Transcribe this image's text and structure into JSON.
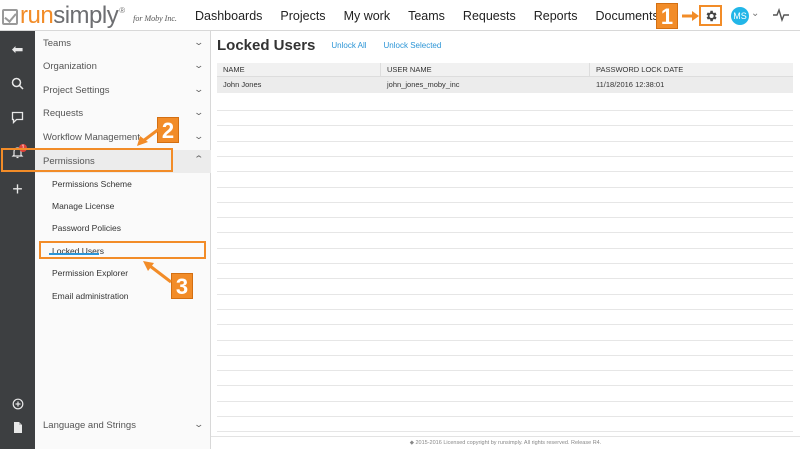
{
  "logo": {
    "run": "run",
    "simply": "simply",
    "reg": "®",
    "for_text": "for Moby Inc."
  },
  "nav": [
    "Dashboards",
    "Projects",
    "My work",
    "Teams",
    "Requests",
    "Reports",
    "Documents"
  ],
  "user": {
    "initials": "MS"
  },
  "rail_icons": [
    "back-arrow-icon",
    "search-icon",
    "chat-icon",
    "bell-icon",
    "plus-icon",
    "add-circle-icon",
    "document-icon"
  ],
  "notifications_badge": "1",
  "sidebar": {
    "items": [
      {
        "label": "Teams"
      },
      {
        "label": "Organization"
      },
      {
        "label": "Project Settings"
      },
      {
        "label": "Requests"
      },
      {
        "label": "Workflow Management"
      },
      {
        "label": "Permissions"
      }
    ],
    "sub_items": [
      {
        "label": "Permissions Scheme"
      },
      {
        "label": "Manage License"
      },
      {
        "label": "Password Policies"
      },
      {
        "label": "Locked Users"
      },
      {
        "label": "Permission Explorer"
      },
      {
        "label": "Email administration"
      }
    ],
    "bottom_item": {
      "label": "Language and Strings"
    }
  },
  "main": {
    "title": "Locked Users",
    "unlock_all": "Unlock All",
    "unlock_selected": "Unlock Selected",
    "columns": [
      "NAME",
      "USER NAME",
      "PASSWORD LOCK DATE"
    ],
    "rows": [
      {
        "name": "John Jones",
        "username": "john_jones_moby_inc",
        "lock_date": "11/18/2016 12:38:01"
      }
    ]
  },
  "footer": "◆ 2015-2016 Licensed copyright by runsimply. All rights reserved. Release R4.",
  "callouts": [
    "1",
    "2",
    "3"
  ],
  "colors": {
    "accent": "#f28c28",
    "link": "#2c95d6",
    "rail": "#3d3f41",
    "avatar": "#22b6e8"
  }
}
